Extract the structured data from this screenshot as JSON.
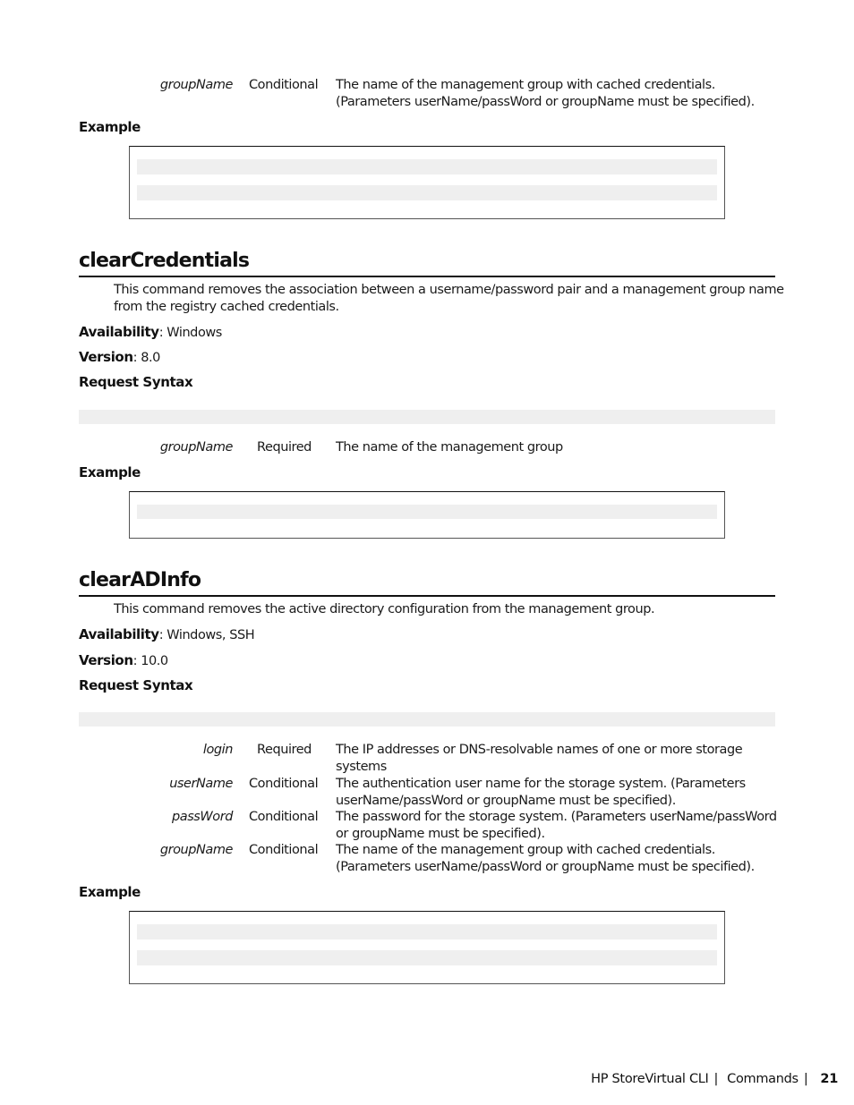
{
  "top_params": {
    "rows": [
      {
        "name": "groupName",
        "requirement": "Conditional",
        "description_lines": [
          "The name of the management group with cached credentials.",
          "(Parameters userName/passWord or groupName must be specified)."
        ]
      }
    ],
    "example_label": "Example",
    "example_lines": 2
  },
  "sections": [
    {
      "title": "clearCredentials",
      "description_lines": [
        "This command removes the association between a username/password pair and a management group name",
        "from the registry cached credentials."
      ],
      "availability_label": "Availability",
      "availability_value": ": Windows",
      "version_label": "Version",
      "version_value": ": 8.0",
      "request_syntax_label": "Request Syntax",
      "params": [
        {
          "name": "groupName",
          "requirement": "Required",
          "description_lines": [
            "The name of the management group"
          ]
        }
      ],
      "example_label": "Example",
      "example_lines": 1
    },
    {
      "title": "clearADInfo",
      "description_lines": [
        "This command removes the active directory configuration from the management group."
      ],
      "availability_label": "Availability",
      "availability_value": ": Windows, SSH",
      "version_label": "Version",
      "version_value": ": 10.0",
      "request_syntax_label": "Request Syntax",
      "params": [
        {
          "name": "login",
          "requirement": "Required",
          "description_lines": [
            "The IP addresses or DNS-resolvable names of one or more storage",
            "systems"
          ]
        },
        {
          "name": "userName",
          "requirement": "Conditional",
          "description_lines": [
            "The authentication user name for the storage system. (Parameters",
            "userName/passWord or groupName must be specified)."
          ]
        },
        {
          "name": "passWord",
          "requirement": "Conditional",
          "description_lines": [
            "The password for the storage system. (Parameters userName/passWord",
            "or groupName must be specified)."
          ]
        },
        {
          "name": "groupName",
          "requirement": "Conditional",
          "description_lines": [
            "The name of the management group with cached credentials.",
            "(Parameters userName/passWord or groupName must be specified)."
          ]
        }
      ],
      "example_label": "Example",
      "example_lines": 2
    }
  ],
  "footer": {
    "product": "HP StoreVirtual CLI",
    "chapter": "Commands",
    "separator": "|",
    "page_number": "21"
  },
  "colors": {
    "code_background": "#efefef",
    "text": "#1a1a1a",
    "rule": "#111111"
  }
}
